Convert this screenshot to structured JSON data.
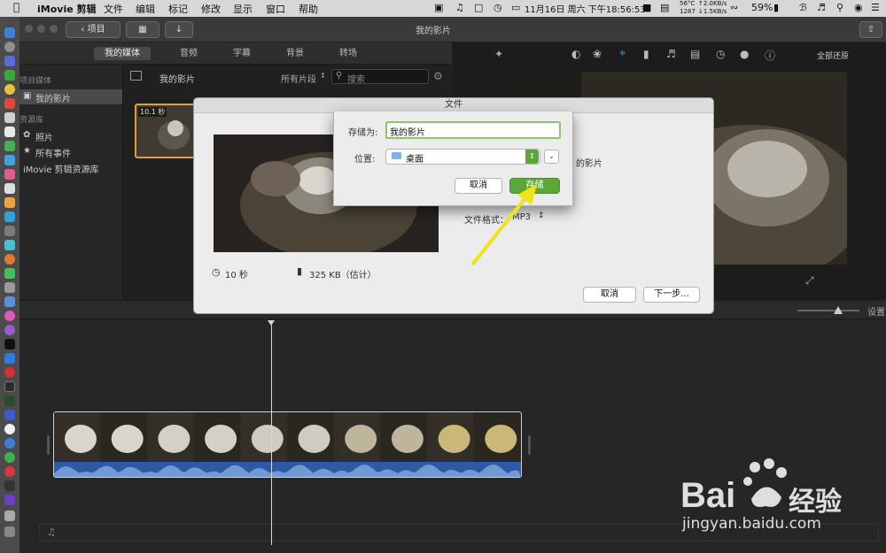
{
  "menubar": {
    "app_name": "iMovie 剪辑",
    "menus": [
      "文件",
      "编辑",
      "标记",
      "修改",
      "显示",
      "窗口",
      "帮助"
    ],
    "temp": "56°C",
    "fan": "1287",
    "net_up": "↑2.0KB/s",
    "net_down": "↓1.5KB/s",
    "datetime": "11月16日 周六 下午18:56:53",
    "battery": "59%"
  },
  "toolbar": {
    "back_label": "项目",
    "window_title": "我的影片"
  },
  "browser_tabs": [
    "我的媒体",
    "音频",
    "字幕",
    "背景",
    "转场"
  ],
  "sidebar": {
    "project_section": "项目媒体",
    "project_item": "我的影片",
    "library_section": "资源库",
    "items": [
      "照片",
      "所有事件",
      "iMovie 剪辑资源库"
    ]
  },
  "browser": {
    "title": "我的影片",
    "filter": "所有片段",
    "search_placeholder": "搜索",
    "clip_duration": "10.1 秒"
  },
  "viewer": {
    "reset_all": "全部还原"
  },
  "timeline": {
    "settings": "设置"
  },
  "dialog": {
    "title": "文件",
    "duration": "10 秒",
    "size": "325 KB（估计）",
    "name_suffix": "的影片",
    "format_label": "文件格式：",
    "format_value": "MP3",
    "cancel_label": "取消",
    "next_label": "下一步..."
  },
  "save_sheet": {
    "save_as_label": "存储为:",
    "save_as_value": "我的影片",
    "location_label": "位置:",
    "location_value": "桌面",
    "cancel_label": "取消",
    "save_label": "存储"
  },
  "watermark": {
    "brand": "Bai",
    "brand2": "经验",
    "url": "jingyan.baidu.com"
  },
  "colors": {
    "accent_green": "#5aa839",
    "annotation_arrow": "#f2e21a",
    "audio_wave": "#2d5aa6"
  }
}
